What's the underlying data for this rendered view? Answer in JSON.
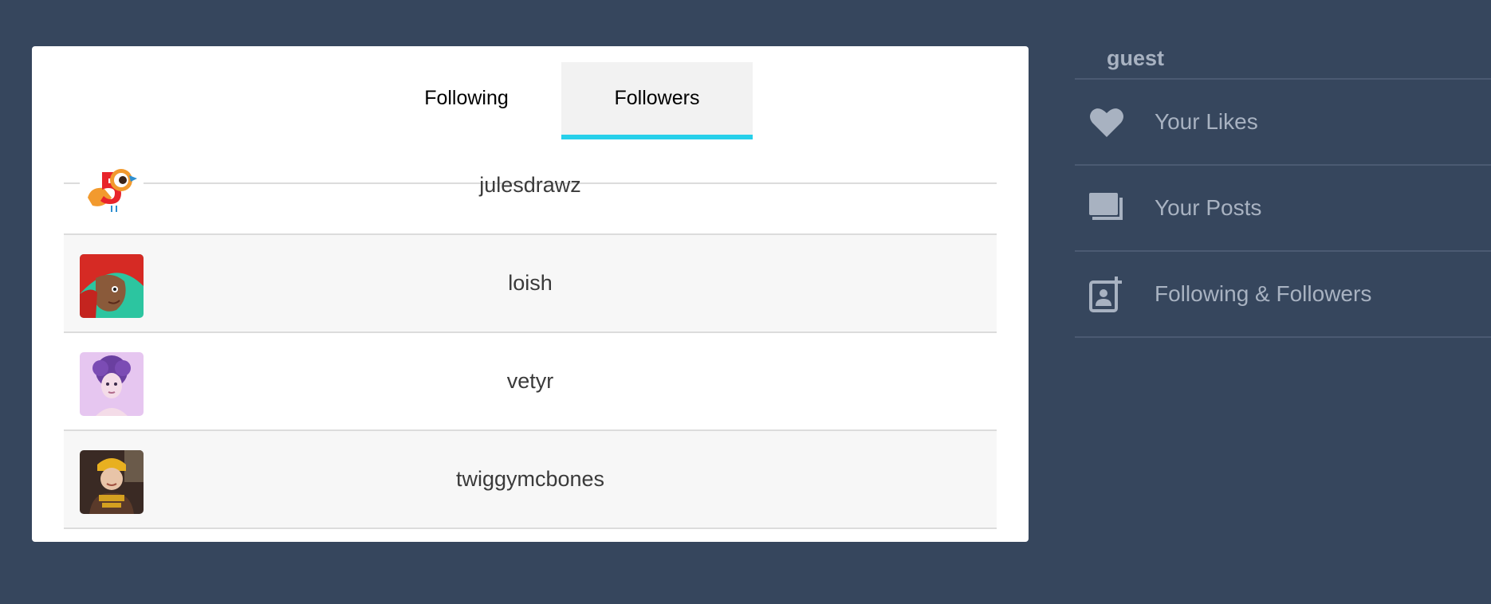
{
  "tabs": {
    "following_label": "Following",
    "followers_label": "Followers",
    "active": "Followers",
    "accent_color": "#27d0ea"
  },
  "followers": [
    {
      "name": "julesdrawz",
      "avatar_icon": "bird-logo-avatar"
    },
    {
      "name": "loish",
      "avatar_icon": "red-hair-portrait-avatar"
    },
    {
      "name": "vetyr",
      "avatar_icon": "purple-hair-portrait-avatar"
    },
    {
      "name": "twiggymcbones",
      "avatar_icon": "photo-portrait-avatar"
    }
  ],
  "sidebar": {
    "username": "guest",
    "items": [
      {
        "label": "Your Likes",
        "icon": "heart-icon"
      },
      {
        "label": "Your Posts",
        "icon": "posts-stack-icon"
      },
      {
        "label": "Following & Followers",
        "icon": "add-contact-icon"
      }
    ]
  },
  "colors": {
    "background": "#36465d",
    "card": "#ffffff",
    "sidebar_text": "#a8b2c1"
  }
}
